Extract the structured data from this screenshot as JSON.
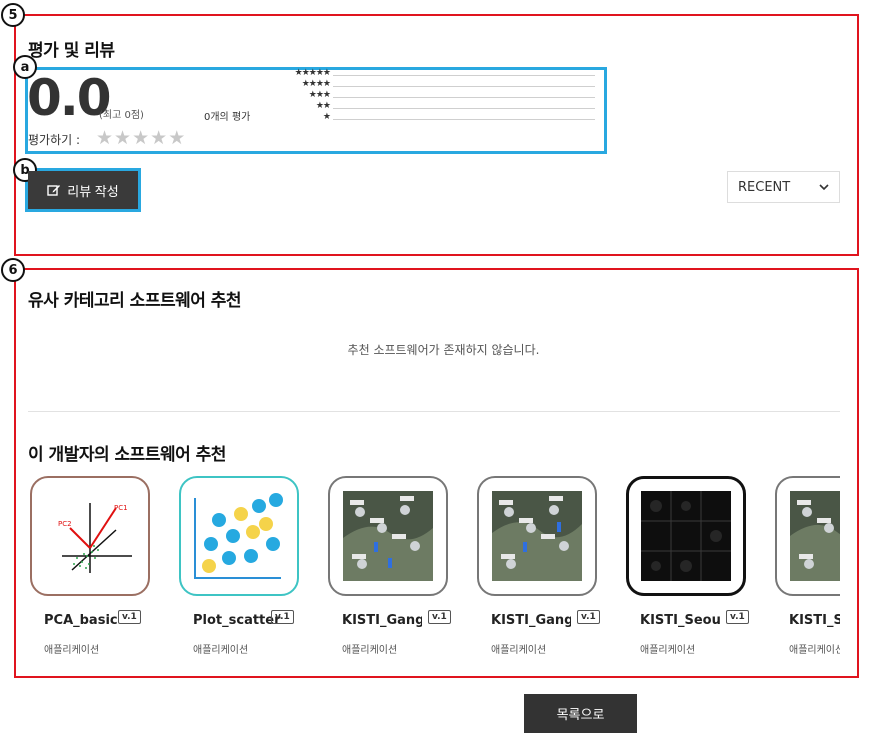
{
  "markers": {
    "m5": "5",
    "m6": "6",
    "ma": "a",
    "mb": "b"
  },
  "rating": {
    "title": "평가 및 리뷰",
    "score": "0.0",
    "max_note": "(최고 0점)",
    "count_label": "0개의 평가",
    "rate_label": "평가하기 :",
    "distribution": [
      {
        "stars": "★★★★★",
        "fraction": 0
      },
      {
        "stars": "★★★★",
        "fraction": 0
      },
      {
        "stars": "★★★",
        "fraction": 0
      },
      {
        "stars": "★★",
        "fraction": 0
      },
      {
        "stars": "★",
        "fraction": 0
      }
    ],
    "review_button": "리뷰 작성",
    "sort_value": "RECENT"
  },
  "similar": {
    "title": "유사 카테고리 소프트웨어 추천",
    "empty_message": "추천 소프트웨어가 존재하지 않습니다."
  },
  "developer": {
    "title": "이 개발자의 소프트웨어 추천",
    "cards": [
      {
        "name": "PCA_basic",
        "version": "v.1",
        "type": "애플리케이션"
      },
      {
        "name": "Plot_scatter",
        "version": "v.1",
        "type": "애플리케이션"
      },
      {
        "name": "KISTI_Gang…",
        "version": "v.1",
        "type": "애플리케이션"
      },
      {
        "name": "KISTI_Gang…",
        "version": "v.1",
        "type": "애플리케이션"
      },
      {
        "name": "KISTI_Seoul…",
        "version": "v.1",
        "type": "애플리케이션"
      },
      {
        "name": "KISTI_Seou",
        "version": "",
        "type": "애플리케이션"
      }
    ]
  },
  "footer": {
    "list_button": "목록으로"
  },
  "colors": {
    "annotation_red": "#e0141e",
    "annotation_blue": "#29a8e0",
    "button_dark": "#333333"
  }
}
